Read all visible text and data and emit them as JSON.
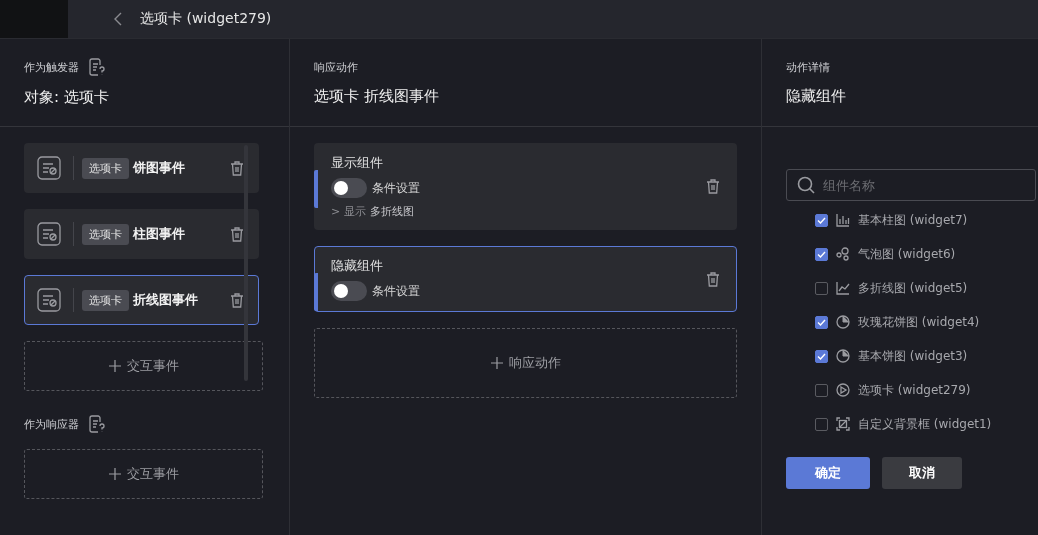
{
  "header": {
    "title": "选项卡 (widget279)"
  },
  "trigger": {
    "label": "作为触发器",
    "object": "对象: 选项卡",
    "events": [
      {
        "tag": "选项卡",
        "name": "饼图事件",
        "selected": false
      },
      {
        "tag": "选项卡",
        "name": "柱图事件",
        "selected": false
      },
      {
        "tag": "选项卡",
        "name": "折线图事件",
        "selected": true
      }
    ],
    "add_label": "交互事件"
  },
  "responder": {
    "label": "作为响应器",
    "add_label": "交互事件"
  },
  "actions": {
    "label": "响应动作",
    "title": "选项卡 折线图事件",
    "items": [
      {
        "name": "显示组件",
        "toggle_label": "条件设置",
        "on": false,
        "selected": false,
        "detail_verb": "> 显示",
        "detail_target": "多折线图"
      },
      {
        "name": "隐藏组件",
        "toggle_label": "条件设置",
        "on": false,
        "selected": true
      }
    ],
    "add_label": "响应动作"
  },
  "details": {
    "label": "动作详情",
    "title": "隐藏组件",
    "search": {
      "placeholder": "组件名称"
    },
    "widgets": [
      {
        "kind": "bar",
        "label": "基本柱图 (widget7)",
        "checked": true
      },
      {
        "kind": "bubble",
        "label": "气泡图 (widget6)",
        "checked": true
      },
      {
        "kind": "line",
        "label": "多折线图 (widget5)",
        "checked": false
      },
      {
        "kind": "pie",
        "label": "玫瑰花饼图 (widget4)",
        "checked": true
      },
      {
        "kind": "pie",
        "label": "基本饼图 (widget3)",
        "checked": true
      },
      {
        "kind": "tab",
        "label": "选项卡 (widget279)",
        "checked": false
      },
      {
        "kind": "frame",
        "label": "自定义背景框 (widget1)",
        "checked": false
      }
    ],
    "buttons": [
      {
        "label": "确定",
        "kind": "primary"
      },
      {
        "label": "取消",
        "kind": "secondary"
      }
    ]
  }
}
